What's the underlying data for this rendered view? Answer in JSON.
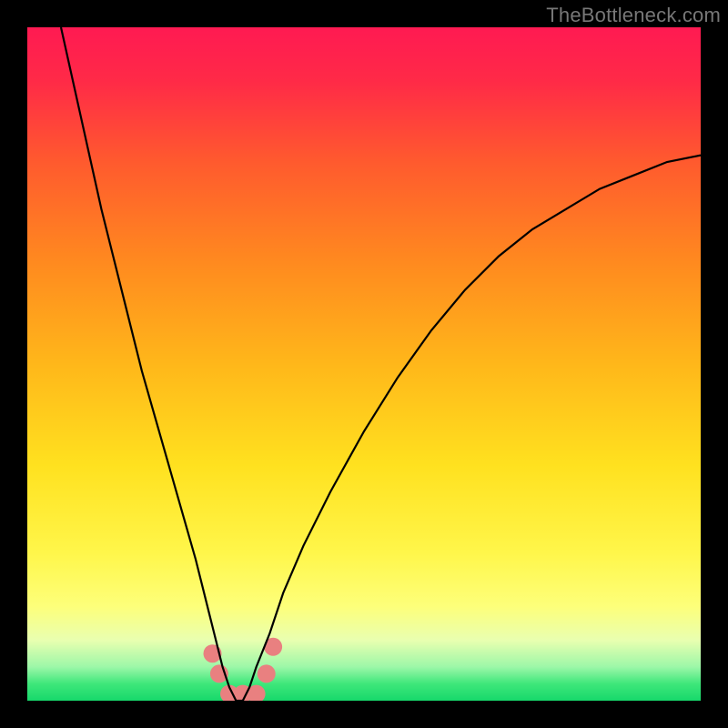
{
  "watermark": "TheBottleneck.com",
  "chart_data": {
    "type": "line",
    "title": "",
    "xlabel": "",
    "ylabel": "",
    "xlim": [
      0,
      100
    ],
    "ylim": [
      0,
      100
    ],
    "gradient_stops": [
      {
        "pos": 0.0,
        "color": "#ff1a52"
      },
      {
        "pos": 0.08,
        "color": "#ff2a47"
      },
      {
        "pos": 0.2,
        "color": "#ff5a2e"
      },
      {
        "pos": 0.35,
        "color": "#ff8a1f"
      },
      {
        "pos": 0.5,
        "color": "#ffb71a"
      },
      {
        "pos": 0.65,
        "color": "#ffe11f"
      },
      {
        "pos": 0.78,
        "color": "#fff64a"
      },
      {
        "pos": 0.86,
        "color": "#fdff7a"
      },
      {
        "pos": 0.91,
        "color": "#e9ffb0"
      },
      {
        "pos": 0.95,
        "color": "#9cf7a8"
      },
      {
        "pos": 0.975,
        "color": "#3ee77a"
      },
      {
        "pos": 1.0,
        "color": "#17d86b"
      }
    ],
    "series": [
      {
        "name": "bottleneck-curve",
        "color": "#000000",
        "x": [
          5,
          7,
          9,
          11,
          13,
          15,
          17,
          19,
          21,
          23,
          25,
          26,
          27,
          28,
          29,
          30,
          31,
          32,
          33,
          34,
          36,
          38,
          41,
          45,
          50,
          55,
          60,
          65,
          70,
          75,
          80,
          85,
          90,
          95,
          100
        ],
        "y": [
          100,
          91,
          82,
          73,
          65,
          57,
          49,
          42,
          35,
          28,
          21,
          17,
          13,
          9,
          5,
          2,
          0,
          0,
          2,
          5,
          10,
          16,
          23,
          31,
          40,
          48,
          55,
          61,
          66,
          70,
          73,
          76,
          78,
          80,
          81
        ]
      }
    ],
    "markers": {
      "color": "#e98080",
      "radius_px": 10,
      "points": [
        {
          "x": 27.5,
          "y": 7
        },
        {
          "x": 28.5,
          "y": 4
        },
        {
          "x": 30.0,
          "y": 1
        },
        {
          "x": 32.0,
          "y": 1
        },
        {
          "x": 34.0,
          "y": 1
        },
        {
          "x": 35.5,
          "y": 4
        },
        {
          "x": 36.5,
          "y": 8
        }
      ]
    }
  }
}
